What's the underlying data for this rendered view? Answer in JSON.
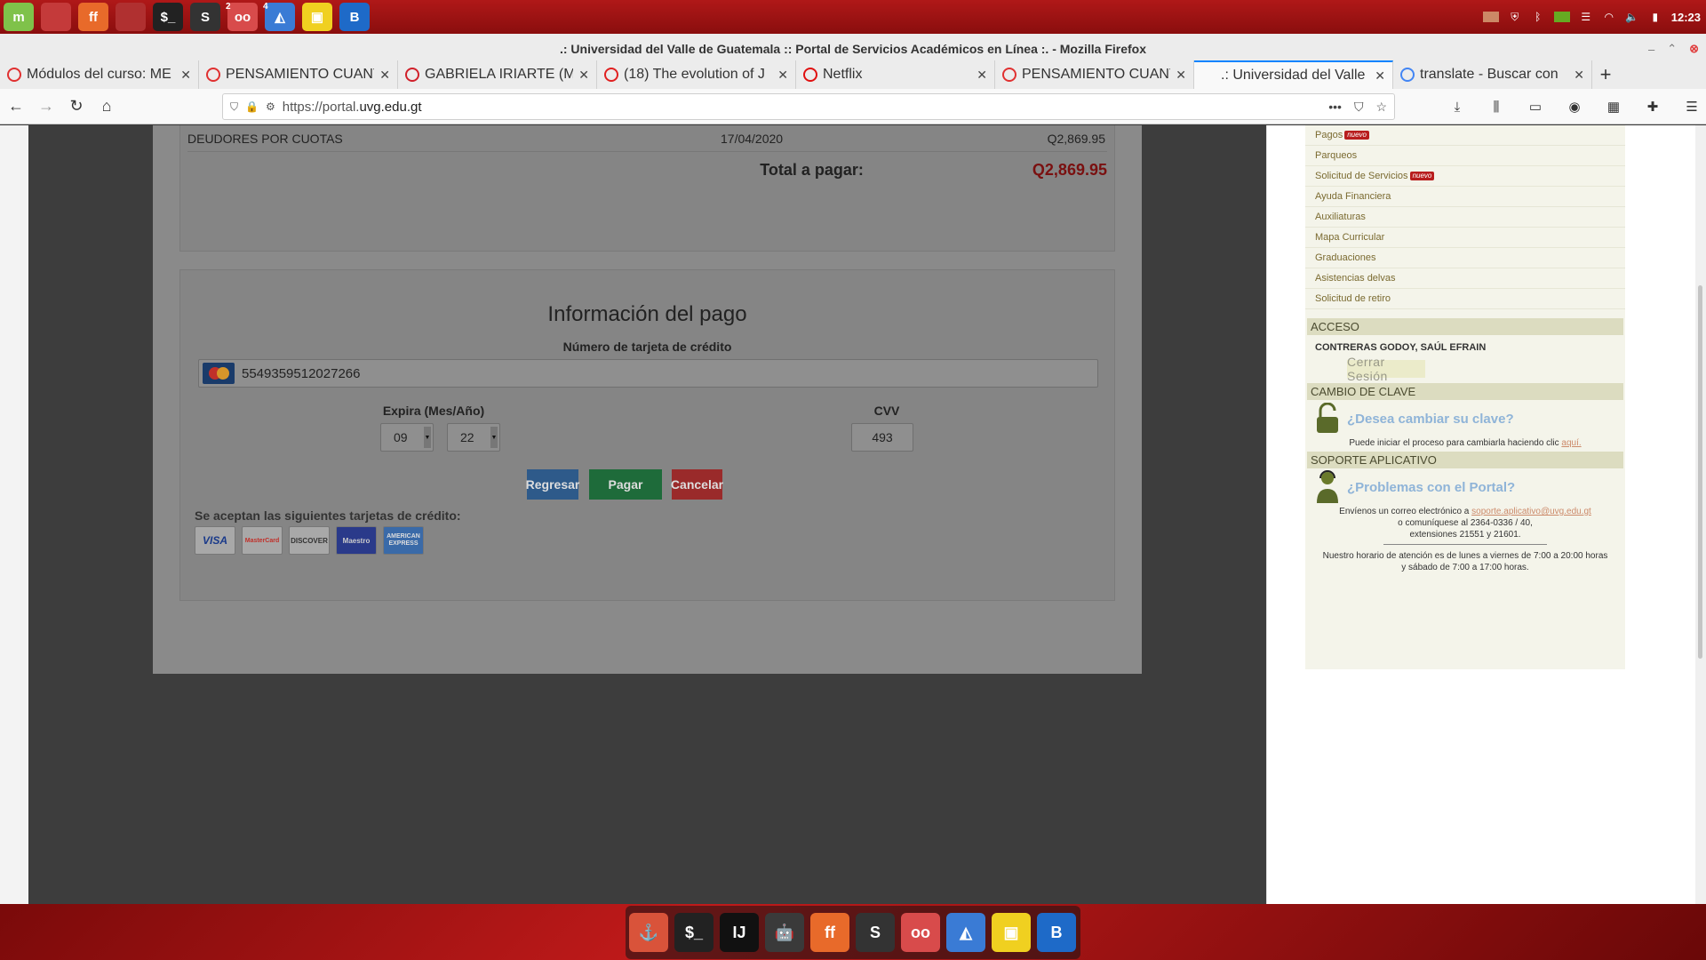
{
  "window": {
    "title": ".: Universidad del Valle de Guatemala :: Portal de Servicios Académicos en Línea :. - Mozilla Firefox",
    "time": "12:23"
  },
  "taskbar": {
    "launchers": [
      {
        "name": "mint-menu-icon",
        "label": "m",
        "color": "#7fc24a"
      },
      {
        "name": "show-desktop-icon",
        "label": "",
        "color": "#c43a3a"
      },
      {
        "name": "firefox-icon",
        "label": "ff",
        "color": "#e86a2a"
      },
      {
        "name": "files-icon",
        "label": "",
        "color": "#b03030"
      },
      {
        "name": "terminal-icon",
        "label": "$_",
        "color": "#222"
      },
      {
        "name": "sublime-icon",
        "label": "S",
        "color": "#333"
      },
      {
        "name": "glasses-icon",
        "label": "oo",
        "color": "#d84b4b",
        "badge": "2"
      },
      {
        "name": "mail-icon",
        "label": "◭",
        "color": "#3a7bd5",
        "badge": "4"
      },
      {
        "name": "notes-icon",
        "label": "▣",
        "color": "#f0d020"
      },
      {
        "name": "bluej-icon",
        "label": "B",
        "color": "#1e6ac8"
      }
    ]
  },
  "tabs": [
    {
      "label": "Módulos del curso: ME",
      "fav": "#e03030",
      "active": false
    },
    {
      "label": "PENSAMIENTO CUANT",
      "fav": "#e03030",
      "active": false
    },
    {
      "label": "GABRIELA IRIARTE (M",
      "fav": "#d0202a",
      "active": false
    },
    {
      "label": "(18) The evolution of J",
      "fav": "#e02020",
      "active": false
    },
    {
      "label": "Netflix",
      "fav": "#e01010",
      "active": false
    },
    {
      "label": "PENSAMIENTO CUANT",
      "fav": "#e03030",
      "active": false
    },
    {
      "label": ".: Universidad del Valle de",
      "fav": "",
      "active": true
    },
    {
      "label": "translate - Buscar con",
      "fav": "#4285f4",
      "active": false
    }
  ],
  "url": {
    "prefix": "https://portal.",
    "host": "uvg.edu.gt"
  },
  "payment": {
    "debt": {
      "concept": "DEUDORES POR CUOTAS",
      "date": "17/04/2020",
      "amount": "Q2,869.95"
    },
    "total_label": "Total a pagar:",
    "total_amount": "Q2,869.95",
    "title": "Información del pago",
    "card_label": "Número de tarjeta de crédito",
    "card_number": "5549359512027266",
    "expiry_label": "Expira (Mes/Año)",
    "month": "09",
    "year": "22",
    "cvv_label": "CVV",
    "cvv": "493",
    "buttons": {
      "back": "Regresar",
      "pay": "Pagar",
      "cancel": "Cancelar"
    },
    "accepted_label": "Se aceptan las siguientes tarjetas de crédito:",
    "cards": [
      "VISA",
      "MasterCard",
      "DISCOVER",
      "Maestro",
      "AMERICAN EXPRESS"
    ],
    "colors": {
      "back": "#2e5a8a",
      "pay": "#1e6b3a",
      "cancel": "#9a2a2a"
    }
  },
  "sidebar": {
    "menu": [
      {
        "label": "Pagos",
        "new": "nuevo"
      },
      {
        "label": "Parqueos",
        "new": ""
      },
      {
        "label": "Solicitud de Servicios",
        "new": "nuevo"
      },
      {
        "label": "Ayuda Financiera",
        "new": ""
      },
      {
        "label": "Auxiliaturas",
        "new": ""
      },
      {
        "label": "Mapa Curricular",
        "new": ""
      },
      {
        "label": "Graduaciones",
        "new": ""
      },
      {
        "label": "Asistencias delvas",
        "new": ""
      },
      {
        "label": "Solicitud de retiro",
        "new": ""
      }
    ],
    "access": {
      "title": "ACCESO",
      "user": "CONTRERAS GODOY, SAÚL EFRAIN",
      "logout": "Cerrar Sesión"
    },
    "password": {
      "title": "CAMBIO DE CLAVE",
      "question": "¿Desea cambiar su clave?",
      "text": "Puede iniciar el proceso para cambiarla haciendo clic",
      "link": "aquí."
    },
    "support": {
      "title": "SOPORTE APLICATIVO",
      "question": "¿Problemas con el Portal?",
      "line1": "Envíenos un correo electrónico a",
      "email": "soporte.aplicativo@uvg.edu.gt",
      "line2": "o comuníquese al 2364-0336 / 40,",
      "line3": "extensiones 21551 y 21601.",
      "hours1": "Nuestro horario de atención es de lunes a viernes de 7:00 a 20:00 horas",
      "hours2": "y sábado de 7:00 a 17:00 horas."
    }
  },
  "dock": [
    {
      "name": "anchor-icon",
      "label": "⚓",
      "color": "#d9533a"
    },
    {
      "name": "terminal-icon",
      "label": "$_",
      "color": "#222"
    },
    {
      "name": "intellij-icon",
      "label": "IJ",
      "color": "#111"
    },
    {
      "name": "android-icon",
      "label": "🤖",
      "color": "#3a3a3a"
    },
    {
      "name": "firefox-icon",
      "label": "ff",
      "color": "#e86a2a"
    },
    {
      "name": "sublime-icon",
      "label": "S",
      "color": "#333"
    },
    {
      "name": "glasses-icon",
      "label": "oo",
      "color": "#d84b4b"
    },
    {
      "name": "mail-icon",
      "label": "◭",
      "color": "#3a7bd5"
    },
    {
      "name": "notes-icon",
      "label": "▣",
      "color": "#f0d020"
    },
    {
      "name": "bluej-icon",
      "label": "B",
      "color": "#1e6ac8"
    }
  ]
}
